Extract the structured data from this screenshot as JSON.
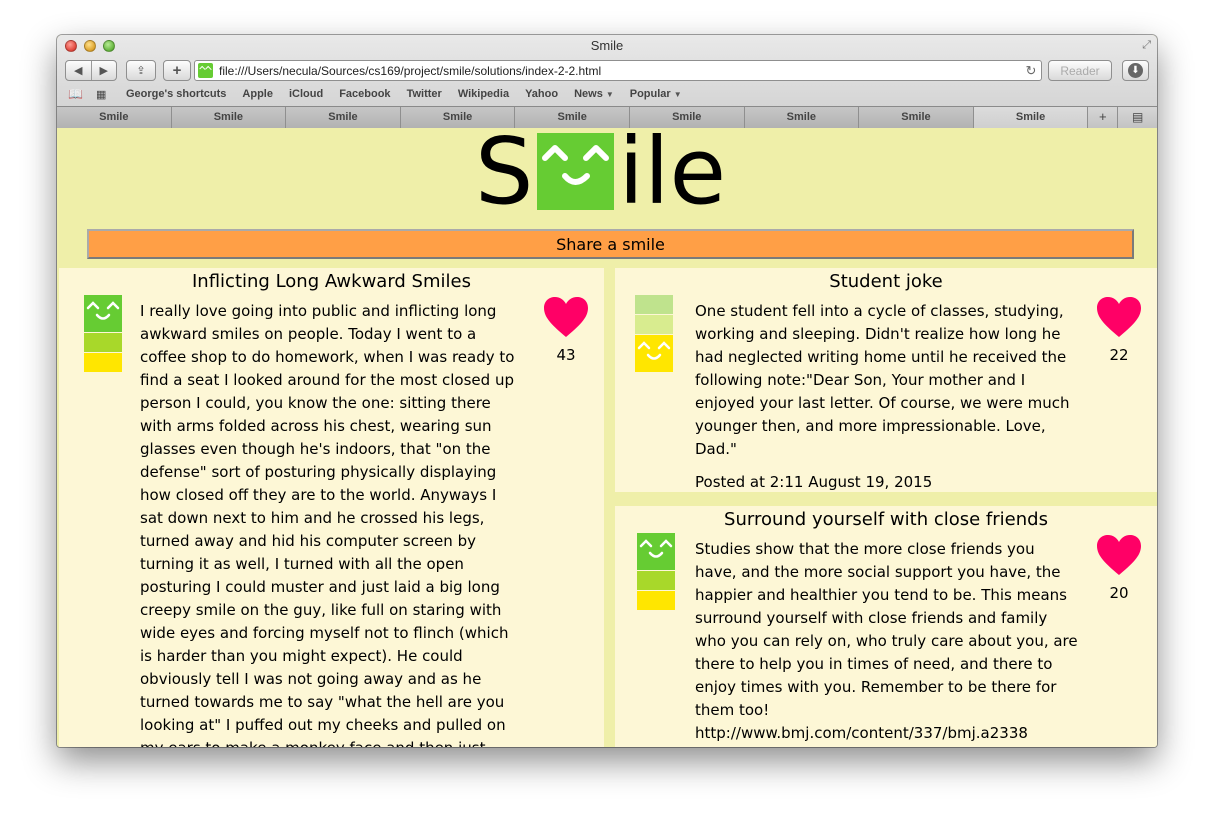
{
  "browser": {
    "window_title": "Smile",
    "url": "file:///Users/necula/Sources/cs169/project/smile/solutions/index-2-2.html",
    "reader_label": "Reader",
    "bookmarks": [
      "George's shortcuts",
      "Apple",
      "iCloud",
      "Facebook",
      "Twitter",
      "Wikipedia",
      "Yahoo",
      "News",
      "Popular"
    ],
    "tabs": [
      "Smile",
      "Smile",
      "Smile",
      "Smile",
      "Smile",
      "Smile",
      "Smile",
      "Smile",
      "Smile"
    ],
    "active_tab_index": 8
  },
  "page": {
    "logo_text_left": "S",
    "logo_text_right": "ile",
    "share_button_label": "Share a smile"
  },
  "posts": [
    {
      "title": "Inflicting Long Awkward Smiles",
      "body": "I really love going into public and inflicting long awkward smiles on people. Today I went to a coffee shop to do homework, when I was ready to find a seat I looked around for the most closed up person I could, you know the one: sitting there with arms folded across his chest, wearing sun glasses even though he's indoors, that \"on the defense\" sort of posturing physically displaying how closed off they are to the world. Anyways I sat down next to him and he crossed his legs, turned away and hid his computer screen by turning it as well, I turned with all the open posturing I could muster and just laid a big long creepy smile on the guy, like full on staring with wide eyes and forcing myself not to flinch (which is harder than you might expect). He could obviously tell I was not going away and as he turned towards me to say \"what the hell are you looking at\" I puffed out my cheeks and pulled on my ears to make a monkey face and then just",
      "likes": "43",
      "happiness_level": "high"
    },
    {
      "title": "Student joke",
      "body": "One student fell into a cycle of classes, studying, working and sleeping. Didn't realize how long he had neglected writing home until he received the following note:\"Dear Son, Your mother and I enjoyed your last letter. Of course, we were much younger then, and more impressionable. Love, Dad.\"",
      "posted": "Posted at 2:11 August 19, 2015",
      "likes": "22",
      "happiness_level": "low"
    },
    {
      "title": "Surround yourself with close friends",
      "body": "Studies show that the more close friends you have, and the more social support you have, the happier and healthier you tend to be. This means surround yourself with close friends and family who you can rely on, who truly care about you, are there to help you in times of need, and there to enjoy times with you. Remember to be there for them too! http://www.bmj.com/content/337/bmj.a2338",
      "likes": "20",
      "happiness_level": "high"
    }
  ],
  "colors": {
    "page_background": "#efefa9",
    "post_background": "#fdf7d6",
    "share_button": "#ff9f46",
    "heart": "#ff0066",
    "meter_green": "#66cc33",
    "meter_lime": "#a8d82a",
    "meter_yellow": "#ffe600",
    "meter_faded_green": "#bfe38d",
    "meter_faded_lime": "#d8ec8f"
  },
  "icons": [
    "reading-list-icon",
    "top-sites-icon",
    "reload-icon",
    "download-icon",
    "heart-icon",
    "smile-face-icon"
  ]
}
